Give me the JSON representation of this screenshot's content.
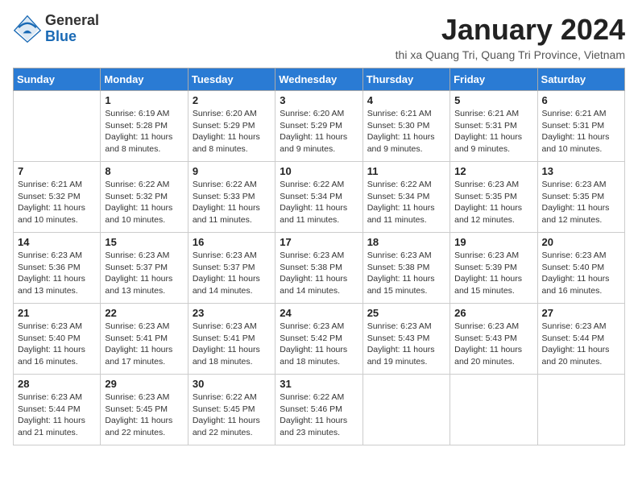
{
  "logo": {
    "general": "General",
    "blue": "Blue"
  },
  "title": "January 2024",
  "location": "thi xa Quang Tri, Quang Tri Province, Vietnam",
  "days_of_week": [
    "Sunday",
    "Monday",
    "Tuesday",
    "Wednesday",
    "Thursday",
    "Friday",
    "Saturday"
  ],
  "weeks": [
    [
      {
        "day": "",
        "sunrise": "",
        "sunset": "",
        "daylight": ""
      },
      {
        "day": "1",
        "sunrise": "Sunrise: 6:19 AM",
        "sunset": "Sunset: 5:28 PM",
        "daylight": "Daylight: 11 hours and 8 minutes."
      },
      {
        "day": "2",
        "sunrise": "Sunrise: 6:20 AM",
        "sunset": "Sunset: 5:29 PM",
        "daylight": "Daylight: 11 hours and 8 minutes."
      },
      {
        "day": "3",
        "sunrise": "Sunrise: 6:20 AM",
        "sunset": "Sunset: 5:29 PM",
        "daylight": "Daylight: 11 hours and 9 minutes."
      },
      {
        "day": "4",
        "sunrise": "Sunrise: 6:21 AM",
        "sunset": "Sunset: 5:30 PM",
        "daylight": "Daylight: 11 hours and 9 minutes."
      },
      {
        "day": "5",
        "sunrise": "Sunrise: 6:21 AM",
        "sunset": "Sunset: 5:31 PM",
        "daylight": "Daylight: 11 hours and 9 minutes."
      },
      {
        "day": "6",
        "sunrise": "Sunrise: 6:21 AM",
        "sunset": "Sunset: 5:31 PM",
        "daylight": "Daylight: 11 hours and 10 minutes."
      }
    ],
    [
      {
        "day": "7",
        "sunrise": "Sunrise: 6:21 AM",
        "sunset": "Sunset: 5:32 PM",
        "daylight": "Daylight: 11 hours and 10 minutes."
      },
      {
        "day": "8",
        "sunrise": "Sunrise: 6:22 AM",
        "sunset": "Sunset: 5:32 PM",
        "daylight": "Daylight: 11 hours and 10 minutes."
      },
      {
        "day": "9",
        "sunrise": "Sunrise: 6:22 AM",
        "sunset": "Sunset: 5:33 PM",
        "daylight": "Daylight: 11 hours and 11 minutes."
      },
      {
        "day": "10",
        "sunrise": "Sunrise: 6:22 AM",
        "sunset": "Sunset: 5:34 PM",
        "daylight": "Daylight: 11 hours and 11 minutes."
      },
      {
        "day": "11",
        "sunrise": "Sunrise: 6:22 AM",
        "sunset": "Sunset: 5:34 PM",
        "daylight": "Daylight: 11 hours and 11 minutes."
      },
      {
        "day": "12",
        "sunrise": "Sunrise: 6:23 AM",
        "sunset": "Sunset: 5:35 PM",
        "daylight": "Daylight: 11 hours and 12 minutes."
      },
      {
        "day": "13",
        "sunrise": "Sunrise: 6:23 AM",
        "sunset": "Sunset: 5:35 PM",
        "daylight": "Daylight: 11 hours and 12 minutes."
      }
    ],
    [
      {
        "day": "14",
        "sunrise": "Sunrise: 6:23 AM",
        "sunset": "Sunset: 5:36 PM",
        "daylight": "Daylight: 11 hours and 13 minutes."
      },
      {
        "day": "15",
        "sunrise": "Sunrise: 6:23 AM",
        "sunset": "Sunset: 5:37 PM",
        "daylight": "Daylight: 11 hours and 13 minutes."
      },
      {
        "day": "16",
        "sunrise": "Sunrise: 6:23 AM",
        "sunset": "Sunset: 5:37 PM",
        "daylight": "Daylight: 11 hours and 14 minutes."
      },
      {
        "day": "17",
        "sunrise": "Sunrise: 6:23 AM",
        "sunset": "Sunset: 5:38 PM",
        "daylight": "Daylight: 11 hours and 14 minutes."
      },
      {
        "day": "18",
        "sunrise": "Sunrise: 6:23 AM",
        "sunset": "Sunset: 5:38 PM",
        "daylight": "Daylight: 11 hours and 15 minutes."
      },
      {
        "day": "19",
        "sunrise": "Sunrise: 6:23 AM",
        "sunset": "Sunset: 5:39 PM",
        "daylight": "Daylight: 11 hours and 15 minutes."
      },
      {
        "day": "20",
        "sunrise": "Sunrise: 6:23 AM",
        "sunset": "Sunset: 5:40 PM",
        "daylight": "Daylight: 11 hours and 16 minutes."
      }
    ],
    [
      {
        "day": "21",
        "sunrise": "Sunrise: 6:23 AM",
        "sunset": "Sunset: 5:40 PM",
        "daylight": "Daylight: 11 hours and 16 minutes."
      },
      {
        "day": "22",
        "sunrise": "Sunrise: 6:23 AM",
        "sunset": "Sunset: 5:41 PM",
        "daylight": "Daylight: 11 hours and 17 minutes."
      },
      {
        "day": "23",
        "sunrise": "Sunrise: 6:23 AM",
        "sunset": "Sunset: 5:41 PM",
        "daylight": "Daylight: 11 hours and 18 minutes."
      },
      {
        "day": "24",
        "sunrise": "Sunrise: 6:23 AM",
        "sunset": "Sunset: 5:42 PM",
        "daylight": "Daylight: 11 hours and 18 minutes."
      },
      {
        "day": "25",
        "sunrise": "Sunrise: 6:23 AM",
        "sunset": "Sunset: 5:43 PM",
        "daylight": "Daylight: 11 hours and 19 minutes."
      },
      {
        "day": "26",
        "sunrise": "Sunrise: 6:23 AM",
        "sunset": "Sunset: 5:43 PM",
        "daylight": "Daylight: 11 hours and 20 minutes."
      },
      {
        "day": "27",
        "sunrise": "Sunrise: 6:23 AM",
        "sunset": "Sunset: 5:44 PM",
        "daylight": "Daylight: 11 hours and 20 minutes."
      }
    ],
    [
      {
        "day": "28",
        "sunrise": "Sunrise: 6:23 AM",
        "sunset": "Sunset: 5:44 PM",
        "daylight": "Daylight: 11 hours and 21 minutes."
      },
      {
        "day": "29",
        "sunrise": "Sunrise: 6:23 AM",
        "sunset": "Sunset: 5:45 PM",
        "daylight": "Daylight: 11 hours and 22 minutes."
      },
      {
        "day": "30",
        "sunrise": "Sunrise: 6:22 AM",
        "sunset": "Sunset: 5:45 PM",
        "daylight": "Daylight: 11 hours and 22 minutes."
      },
      {
        "day": "31",
        "sunrise": "Sunrise: 6:22 AM",
        "sunset": "Sunset: 5:46 PM",
        "daylight": "Daylight: 11 hours and 23 minutes."
      },
      {
        "day": "",
        "sunrise": "",
        "sunset": "",
        "daylight": ""
      },
      {
        "day": "",
        "sunrise": "",
        "sunset": "",
        "daylight": ""
      },
      {
        "day": "",
        "sunrise": "",
        "sunset": "",
        "daylight": ""
      }
    ]
  ]
}
